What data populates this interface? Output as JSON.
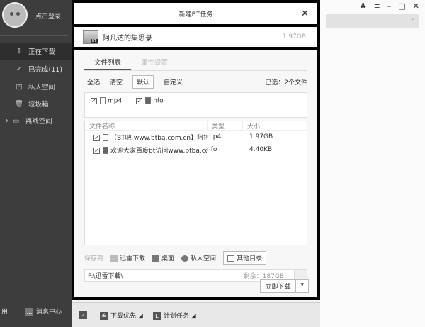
{
  "sidebar": {
    "login": "点击登录",
    "items": [
      {
        "label": "正在下载",
        "icon": "download-icon"
      },
      {
        "label": "已完成(11)",
        "icon": "check-circle-icon"
      },
      {
        "label": "私人空间",
        "icon": "lock-icon"
      },
      {
        "label": "垃圾箱",
        "icon": "trash-icon"
      },
      {
        "label": "离线空间",
        "icon": "cloud-download-icon"
      }
    ],
    "bottom_left": "用",
    "message_center": "消息中心"
  },
  "dialog": {
    "title": "新建BT任务",
    "task_name": "阿凡达的集思录",
    "task_size": "1.97GB",
    "bt_badge": "BT",
    "tabs": [
      "文件列表",
      "属性设置"
    ],
    "toolbar": {
      "select_all": "全选",
      "clear": "清空",
      "default": "默认",
      "custom": "自定义",
      "selected_info": "已选：2个文件"
    },
    "types": [
      {
        "label": "mp4",
        "checked": true
      },
      {
        "label": "nfo",
        "checked": true
      }
    ],
    "columns": [
      "文件名称",
      "类型",
      "大小"
    ],
    "files": [
      {
        "name": "【BT吧-www.btba.com.cn】阿拉...",
        "type": "mp4",
        "size": "1.97GB",
        "checked": true
      },
      {
        "name": "欢迎大家百度bt访问www.btba.co...",
        "type": "nfo",
        "size": "4.40KB",
        "checked": true
      }
    ],
    "save_to": "保存到",
    "save_options": [
      "迅雷下载",
      "桌面",
      "私人空间",
      "其他目录"
    ],
    "path": "F:\\迅雷下载\\",
    "free_space": "剩余：187GB",
    "download_now": "立即下载"
  },
  "bottombar": {
    "priority": "下载优先",
    "schedule": "计划任务"
  }
}
